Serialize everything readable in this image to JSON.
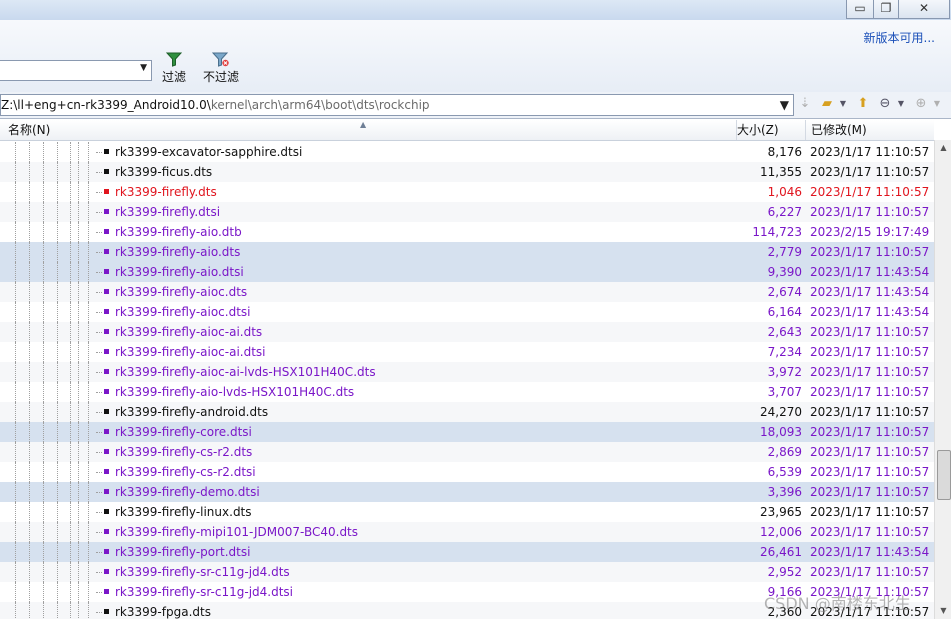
{
  "window": {
    "minimize_label": "▭",
    "restore_label": "❐",
    "close_label": "✕"
  },
  "toolbar": {
    "new_version_label": "新版本可用...",
    "filter_label": "过滤",
    "no_filter_label": "不过滤",
    "filter_combo_value": ""
  },
  "path": {
    "prefix": "Z:\\ll+eng+cn-rk3399_Android10.0\\",
    "rest": "kernel\\arch\\arm64\\boot\\dts\\rockchip"
  },
  "columns": {
    "name": "名称(N)",
    "size": "大小(Z)",
    "modified": "已修改(M)"
  },
  "colors": {
    "black": "#111111",
    "red": "#e0141e",
    "purple": "#7a16c8"
  },
  "files": [
    {
      "name": "rk3399-excavator-sapphire.dtsi",
      "size": "8,176",
      "date": "2023/1/17 11:10:57",
      "color": "black",
      "selected": false
    },
    {
      "name": "rk3399-ficus.dts",
      "size": "11,355",
      "date": "2023/1/17 11:10:57",
      "color": "black",
      "selected": false
    },
    {
      "name": "rk3399-firefly.dts",
      "size": "1,046",
      "date": "2023/1/17 11:10:57",
      "color": "red",
      "selected": false
    },
    {
      "name": "rk3399-firefly.dtsi",
      "size": "6,227",
      "date": "2023/1/17 11:10:57",
      "color": "purple",
      "selected": false
    },
    {
      "name": "rk3399-firefly-aio.dtb",
      "size": "114,723",
      "date": "2023/2/15 19:17:49",
      "color": "purple",
      "selected": false
    },
    {
      "name": "rk3399-firefly-aio.dts",
      "size": "2,779",
      "date": "2023/1/17 11:10:57",
      "color": "purple",
      "selected": true
    },
    {
      "name": "rk3399-firefly-aio.dtsi",
      "size": "9,390",
      "date": "2023/1/17 11:43:54",
      "color": "purple",
      "selected": true
    },
    {
      "name": "rk3399-firefly-aioc.dts",
      "size": "2,674",
      "date": "2023/1/17 11:43:54",
      "color": "purple",
      "selected": false
    },
    {
      "name": "rk3399-firefly-aioc.dtsi",
      "size": "6,164",
      "date": "2023/1/17 11:43:54",
      "color": "purple",
      "selected": false
    },
    {
      "name": "rk3399-firefly-aioc-ai.dts",
      "size": "2,643",
      "date": "2023/1/17 11:10:57",
      "color": "purple",
      "selected": false
    },
    {
      "name": "rk3399-firefly-aioc-ai.dtsi",
      "size": "7,234",
      "date": "2023/1/17 11:10:57",
      "color": "purple",
      "selected": false
    },
    {
      "name": "rk3399-firefly-aioc-ai-lvds-HSX101H40C.dts",
      "size": "3,972",
      "date": "2023/1/17 11:10:57",
      "color": "purple",
      "selected": false
    },
    {
      "name": "rk3399-firefly-aio-lvds-HSX101H40C.dts",
      "size": "3,707",
      "date": "2023/1/17 11:10:57",
      "color": "purple",
      "selected": false
    },
    {
      "name": "rk3399-firefly-android.dts",
      "size": "24,270",
      "date": "2023/1/17 11:10:57",
      "color": "black",
      "selected": false
    },
    {
      "name": "rk3399-firefly-core.dtsi",
      "size": "18,093",
      "date": "2023/1/17 11:10:57",
      "color": "purple",
      "selected": true
    },
    {
      "name": "rk3399-firefly-cs-r2.dts",
      "size": "2,869",
      "date": "2023/1/17 11:10:57",
      "color": "purple",
      "selected": false
    },
    {
      "name": "rk3399-firefly-cs-r2.dtsi",
      "size": "6,539",
      "date": "2023/1/17 11:10:57",
      "color": "purple",
      "selected": false
    },
    {
      "name": "rk3399-firefly-demo.dtsi",
      "size": "3,396",
      "date": "2023/1/17 11:10:57",
      "color": "purple",
      "selected": true
    },
    {
      "name": "rk3399-firefly-linux.dts",
      "size": "23,965",
      "date": "2023/1/17 11:10:57",
      "color": "black",
      "selected": false
    },
    {
      "name": "rk3399-firefly-mipi101-JDM007-BC40.dts",
      "size": "12,006",
      "date": "2023/1/17 11:10:57",
      "color": "purple",
      "selected": false
    },
    {
      "name": "rk3399-firefly-port.dtsi",
      "size": "26,461",
      "date": "2023/1/17 11:43:54",
      "color": "purple",
      "selected": true
    },
    {
      "name": "rk3399-firefly-sr-c11g-jd4.dts",
      "size": "2,952",
      "date": "2023/1/17 11:10:57",
      "color": "purple",
      "selected": false
    },
    {
      "name": "rk3399-firefly-sr-c11g-jd4.dtsi",
      "size": "9,166",
      "date": "2023/1/17 11:10:57",
      "color": "purple",
      "selected": false
    },
    {
      "name": "rk3399-fpga.dts",
      "size": "2,360",
      "date": "2023/1/17 11:10:57",
      "color": "black",
      "selected": false
    }
  ],
  "watermark": "CSDN @南楼东北生"
}
